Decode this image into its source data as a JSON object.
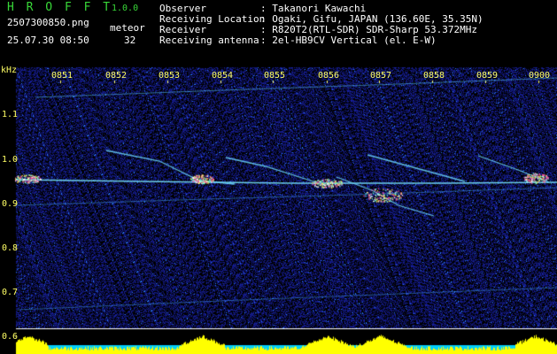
{
  "app": {
    "name": "H R O F F T",
    "version": "1.0.0"
  },
  "file": {
    "name": "2507300850.png",
    "datetime": "25.07.30 08:50"
  },
  "meteor": {
    "label": "meteor",
    "count": "32"
  },
  "info": {
    "labels": [
      "Observer",
      "Receiving Location",
      "Receiver",
      "Receiving antenna"
    ],
    "values": [
      ": Takanori Kawachi",
      ": Ogaki, Gifu, JAPAN (136.60E, 35.35N)",
      ": R820T2(RTL-SDR) SDR-Sharp 53.372MHz",
      ": 2el-HB9CV Vertical (el. E-W)"
    ]
  },
  "axis": {
    "unit": "kHz",
    "y_ticks": [
      "1.1",
      "1.0",
      "0.9",
      "0.8",
      "0.7",
      "0.6"
    ],
    "x_ticks": [
      "0851",
      "0852",
      "0853",
      "0854",
      "0855",
      "0856",
      "0857",
      "0858",
      "0859",
      "0900"
    ]
  },
  "colors": {
    "background": "#000000",
    "header_green": "#38d838",
    "tick_yellow": "#ffff66",
    "signal_cyan": "#00e5ff",
    "level_yellow": "#ffff00",
    "noise_blue": "#1a2a9a"
  }
}
